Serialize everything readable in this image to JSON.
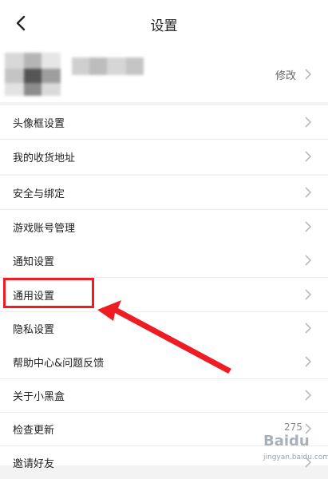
{
  "header": {
    "title": "设置"
  },
  "profile": {
    "modify_label": "修改"
  },
  "menu": [
    {
      "label": "头像框设置"
    },
    {
      "label": "我的收货地址"
    },
    {
      "label": "安全与绑定"
    },
    {
      "label": "游戏账号管理"
    },
    {
      "label": "通知设置"
    },
    {
      "label": "通用设置"
    },
    {
      "label": "隐私设置"
    },
    {
      "label": "帮助中心&问题反馈"
    },
    {
      "label": "关于小黑盒"
    },
    {
      "label": "检查更新"
    },
    {
      "label": "邀请好友"
    }
  ],
  "watermark": {
    "logo": "Baidu",
    "number": "275",
    "sub": "jingyan.baidu.com"
  },
  "colors": {
    "highlight": "#ee1d23",
    "background": "#f3f3f4"
  }
}
